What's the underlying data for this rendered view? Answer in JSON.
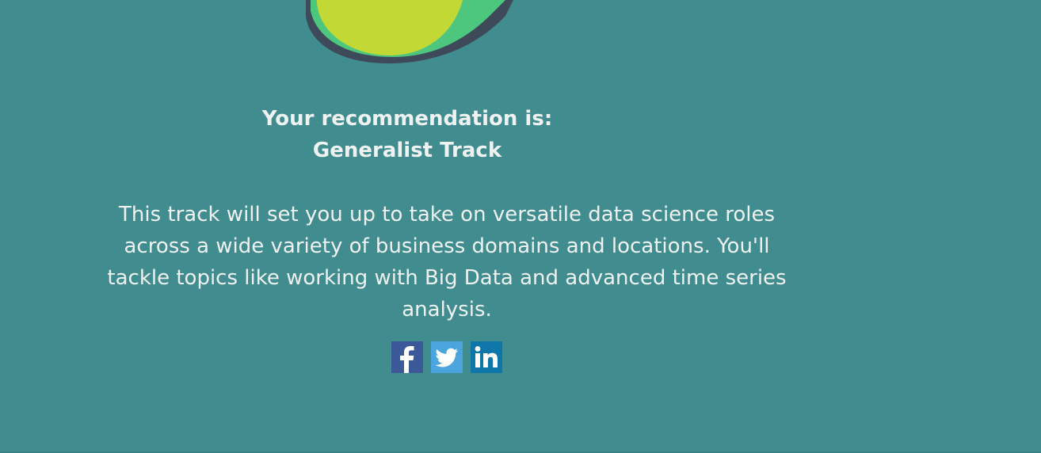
{
  "result": {
    "heading": "Your recommendation is:",
    "track_name": "Generalist Track",
    "description": "This track will set you up to take on versatile data science roles across a wide variety of business domains and locations. You'll tackle topics like working with Big Data and advanced time series analysis."
  },
  "share": {
    "facebook": {
      "icon": "facebook-icon",
      "color": "#3b5998"
    },
    "twitter": {
      "icon": "twitter-icon",
      "color": "#4aa4de"
    },
    "linkedin": {
      "icon": "linkedin-icon",
      "color": "#0e76a8"
    }
  },
  "colors": {
    "background": "#418c8f",
    "text": "#eef3f2",
    "illustration_lime": "#c2d935",
    "illustration_green": "#4ec77e",
    "illustration_outline": "#3e4a5a"
  }
}
